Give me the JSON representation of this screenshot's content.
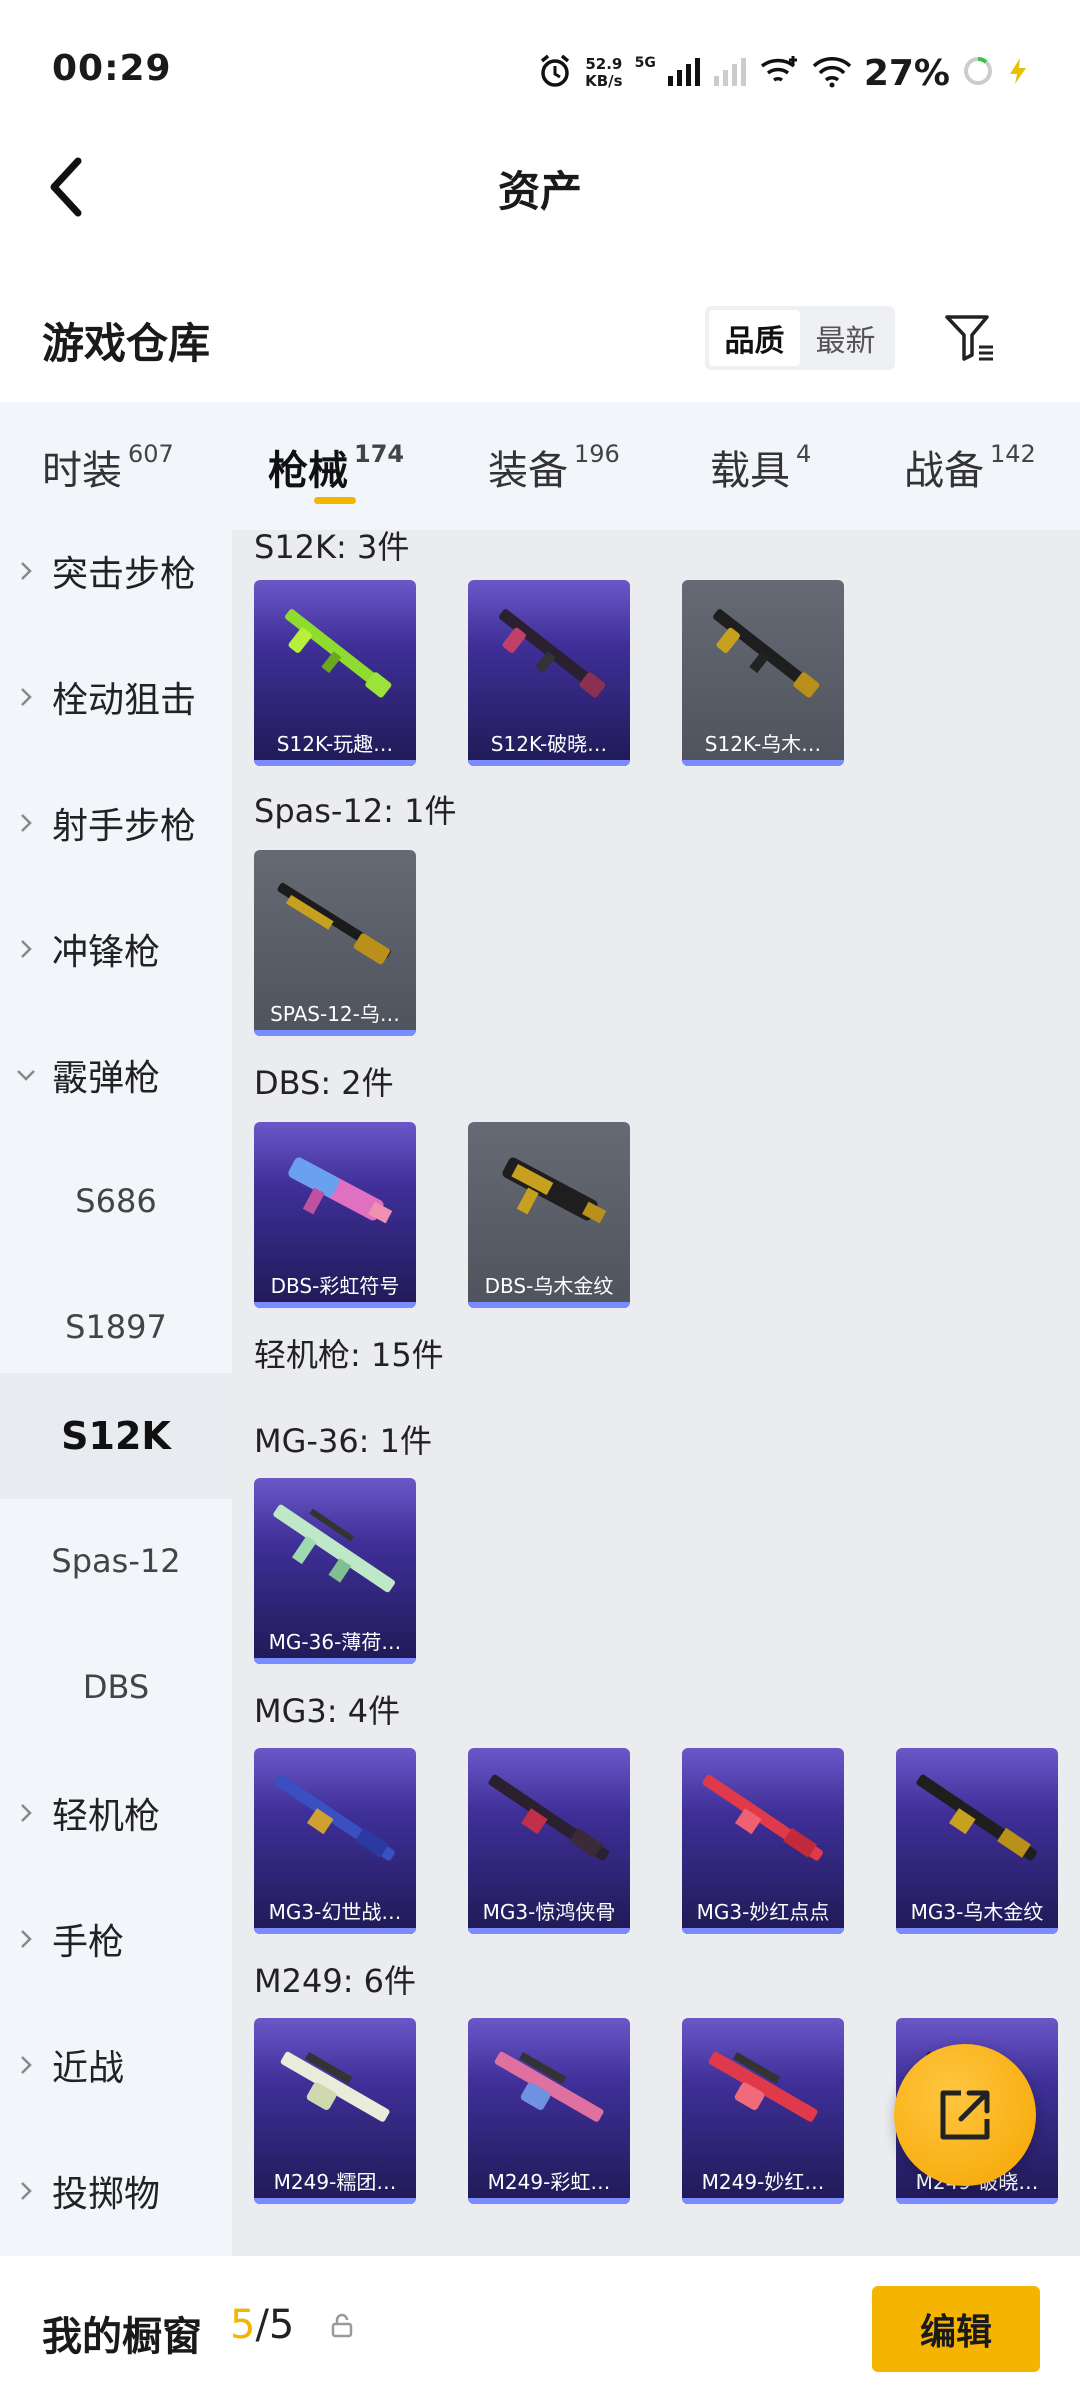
{
  "status_bar": {
    "time": "00:29",
    "net_speed_value": "52.9",
    "net_speed_unit": "KB/s",
    "network_type": "5G",
    "battery_percent": "27%"
  },
  "header": {
    "title": "资产"
  },
  "warehouse": {
    "title": "游戏仓库",
    "sort_options": [
      "品质",
      "最新"
    ],
    "active_sort": "品质"
  },
  "tabs": [
    {
      "label": "时装",
      "count": "607"
    },
    {
      "label": "枪械",
      "count": "174",
      "active": true
    },
    {
      "label": "装备",
      "count": "196"
    },
    {
      "label": "载具",
      "count": "4"
    },
    {
      "label": "战备",
      "count": "142"
    }
  ],
  "sidebar": {
    "categories": [
      "突击步枪",
      "栓动狙击",
      "射手步枪",
      "冲锋枪",
      "霰弹枪",
      "轻机枪",
      "手枪",
      "近战",
      "投掷物"
    ],
    "shotgun_subs": [
      "S686",
      "S1897",
      "S12K",
      "Spas-12",
      "DBS"
    ],
    "active_sub": "S12K"
  },
  "groups": {
    "s12k": "S12K: 3件",
    "spas": "Spas-12: 1件",
    "dbs": "DBS: 2件",
    "lmg": "轻机枪: 15件",
    "mg36": "MG-36: 1件",
    "mg3": "MG3: 4件",
    "m249": "M249: 6件"
  },
  "items": {
    "s12k": [
      "S12K-玩趣…",
      "S12K-破晓…",
      "S12K-乌木…"
    ],
    "spas": [
      "SPAS-12-乌…"
    ],
    "dbs": [
      "DBS-彩虹符号",
      "DBS-乌木金纹"
    ],
    "mg36": [
      "MG-36-薄荷…"
    ],
    "mg3": [
      "MG3-幻世战…",
      "MG3-惊鸿侠骨",
      "MG3-妙红点点",
      "MG3-乌木金纹"
    ],
    "m249": [
      "M249-糯团…",
      "M249-彩虹…",
      "M249-妙红…",
      "M249-破晓…"
    ]
  },
  "bottom_bar": {
    "title": "我的橱窗",
    "count_used": "5",
    "count_total": "/5",
    "edit_label": "编辑"
  },
  "colors": {
    "accent": "#f5b400",
    "rarity_purple": "#3f2f98",
    "rarity_gray": "#55585f",
    "rarity_bar": "#7a8cff"
  }
}
